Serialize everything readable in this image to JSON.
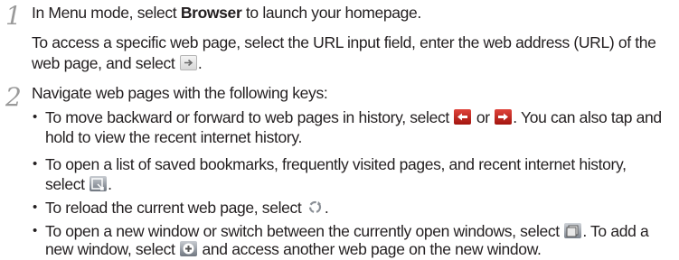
{
  "step1": {
    "number": "1",
    "line1_pre": "In Menu mode, select ",
    "line1_bold": "Browser",
    "line1_post": " to launch your homepage.",
    "line2": "To access a specific web page, select the URL input field, enter the web address (URL) of the",
    "line3_pre": "web page, and select ",
    "line3_post": "."
  },
  "step2": {
    "number": "2",
    "intro": "Navigate web pages with the following keys:",
    "bullet_symbol": "•",
    "b1_l1_pre": "To move backward or forward to web pages in history, select ",
    "b1_l1_mid": " or ",
    "b1_l1_post": ". You can also tap and",
    "b1_l2": "hold to view the recent internet history.",
    "b2_l1": "To open a list of saved bookmarks, frequently visited pages, and recent internet history,",
    "b2_l2_pre": "select ",
    "b2_l2_post": ".",
    "b3_pre": "To reload the current web page, select ",
    "b3_post": ".",
    "b4_l1_pre": "To open a new window or switch between the currently open windows, select ",
    "b4_l1_post": ". To add a",
    "b4_l2_pre": "new window, select ",
    "b4_l2_post": " and access another web page on the new window."
  },
  "icons": {
    "go": "go-arrow-icon",
    "back": "back-arrow-icon",
    "forward": "forward-arrow-icon",
    "bookmarks": "bookmarks-icon",
    "reload": "reload-icon",
    "windows": "windows-icon",
    "new_window": "new-window-icon"
  },
  "colors": {
    "text": "#231f20",
    "step_number": "#9a9a9a",
    "nav_red": "#c0281f"
  }
}
